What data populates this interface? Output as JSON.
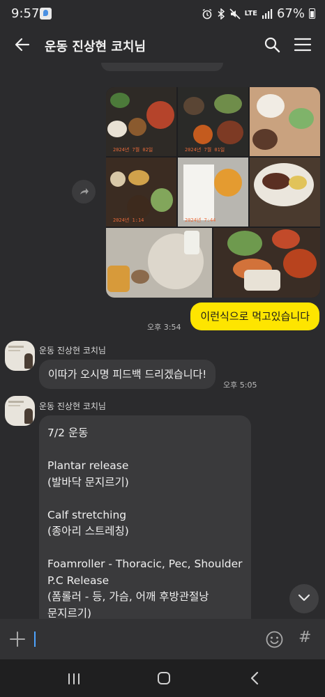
{
  "status_bar": {
    "time": "9:57",
    "network": "LTE",
    "battery": "67%"
  },
  "header": {
    "title": "운동 진상현 코치님",
    "back_icon": "arrow-left-icon",
    "search_icon": "search-icon",
    "menu_icon": "hamburger-menu-icon"
  },
  "messages": {
    "photo_message": {
      "photo_count": 8,
      "photo_stamps": [
        "2024년 7월 02일",
        "2024년 7월 01일",
        "2024년 1:14",
        "2024년 7:44"
      ],
      "share_icon": "share-icon"
    },
    "my_text": {
      "text": "이런식으로  먹고있습니다",
      "time": "오후 3:54"
    },
    "coach_msg_1": {
      "sender": "운동 진상현 코치님",
      "text": "이따가 오시명 피드백 드리겠습니다!",
      "time": "오후 5:05"
    },
    "coach_msg_2": {
      "sender": "운동 진상현 코치님",
      "lines": [
        "7/2 운동",
        "",
        "Plantar release",
        "(발바닥 문지르기)",
        "",
        "Calf stretching",
        "(종아리 스트레칭)",
        "",
        "Foamroller - Thoracic, Pec, Shoulder",
        "P.C Release",
        "(폼롤러 - 등, 가슴, 어깨 후방관절낭",
        "문지르기)"
      ]
    }
  },
  "input_bar": {
    "placeholder": "",
    "plus_icon": "plus-icon",
    "emoji_icon": "emoji-icon",
    "hash_icon": "hashtag-icon",
    "hash_glyph": "#"
  },
  "colors": {
    "background": "#2b2b2d",
    "my_bubble": "#fee500",
    "other_bubble": "#3a3a3c"
  }
}
